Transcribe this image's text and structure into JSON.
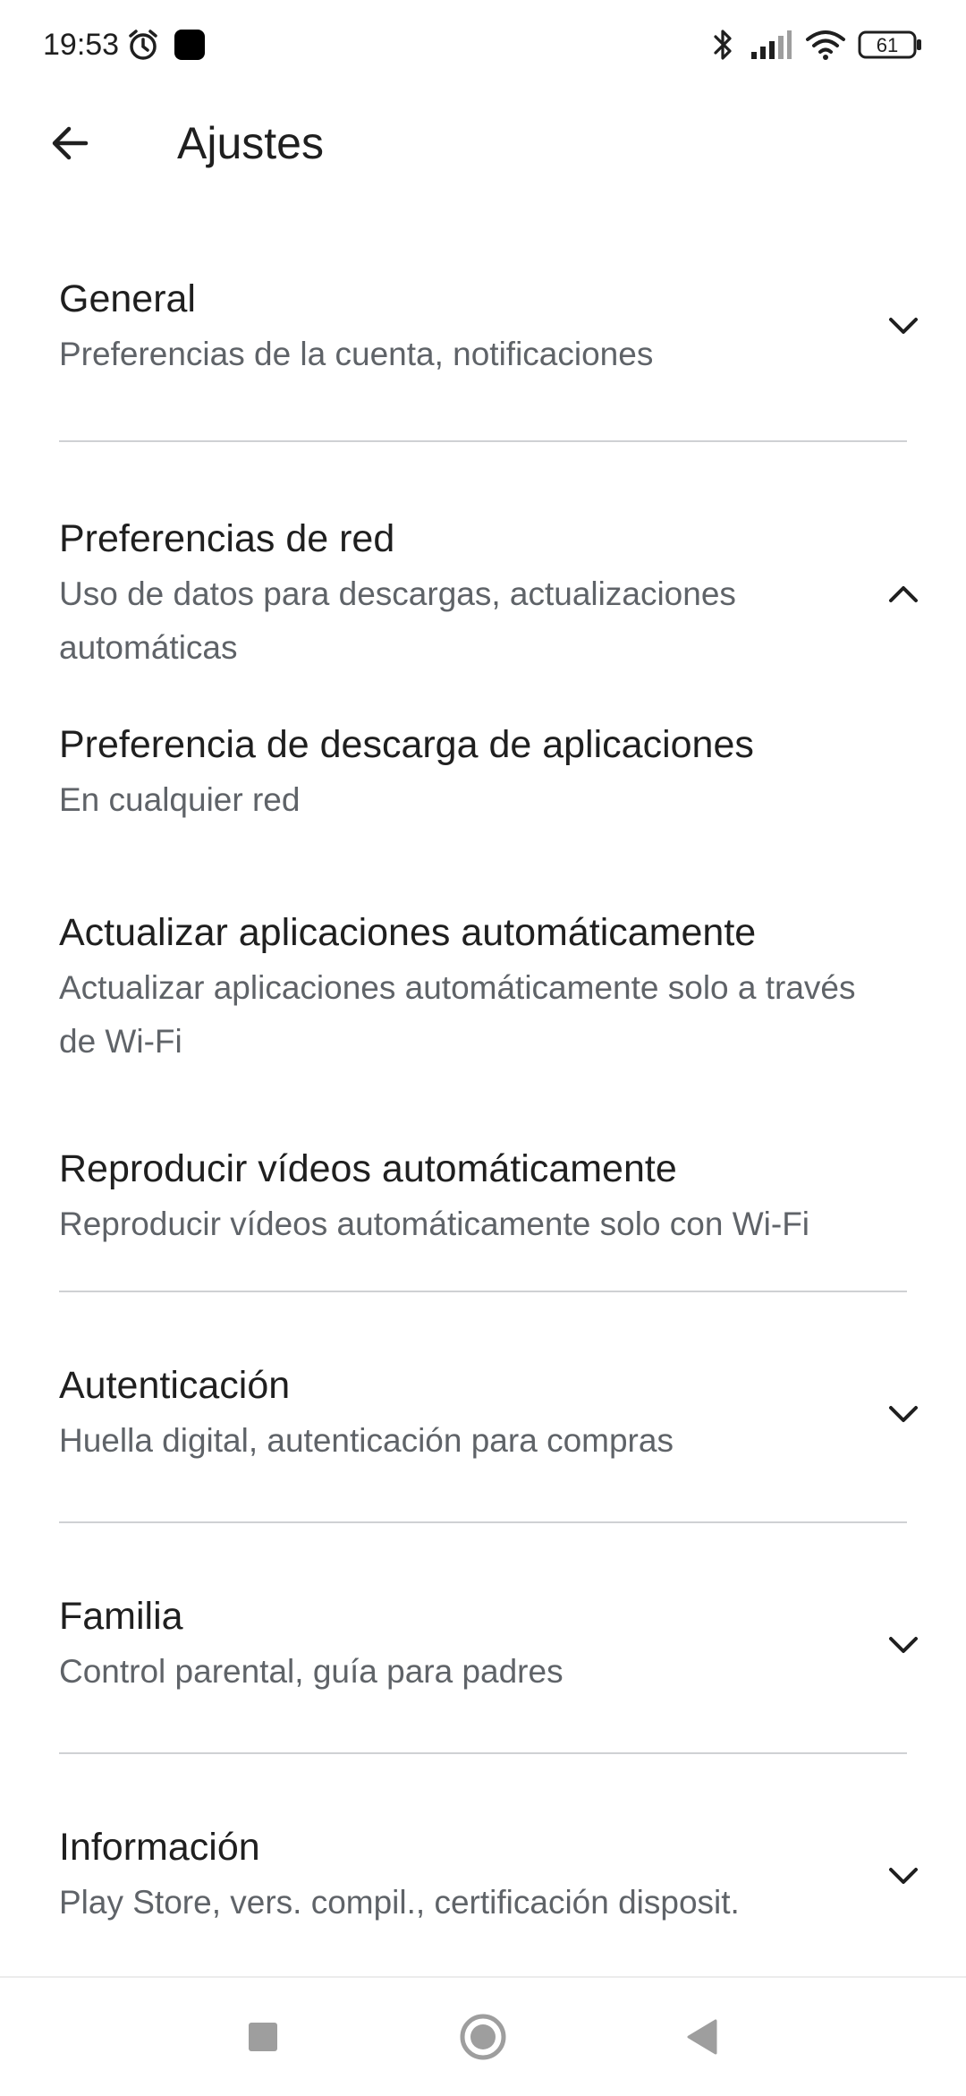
{
  "status_bar": {
    "time": "19:53",
    "battery_level": "61",
    "icons": [
      "alarm-icon",
      "app-notification-icon",
      "bluetooth-icon",
      "signal-icon",
      "wifi-icon",
      "battery-icon"
    ]
  },
  "app_bar": {
    "back_icon": "arrow-back-icon",
    "title": "Ajustes"
  },
  "sections": {
    "general": {
      "title": "General",
      "subtitle": "Preferencias de la cuenta, notificaciones",
      "expanded": false
    },
    "network": {
      "title": "Preferencias de red",
      "subtitle": "Uso de datos para descargas, actualizaciones automáticas",
      "expanded": true,
      "items": {
        "download": {
          "title": "Preferencia de descarga de aplicaciones",
          "subtitle": "En cualquier red"
        },
        "auto_update": {
          "title": "Actualizar aplicaciones automáticamente",
          "subtitle": "Actualizar aplicaciones automáticamente solo a través de Wi-Fi"
        },
        "autoplay": {
          "title": "Reproducir vídeos automáticamente",
          "subtitle": "Reproducir vídeos automáticamente solo con Wi-Fi"
        }
      }
    },
    "auth": {
      "title": "Autenticación",
      "subtitle": "Huella digital, autenticación para compras",
      "expanded": false
    },
    "family": {
      "title": "Familia",
      "subtitle": "Control parental, guía para padres",
      "expanded": false
    },
    "info": {
      "title": "Información",
      "subtitle": "Play Store, vers. compil., certificación disposit.",
      "expanded": false
    }
  },
  "nav_bar": {
    "buttons": [
      "recents-icon",
      "home-icon",
      "back-triangle-icon"
    ]
  },
  "colors": {
    "text_primary": "#1f1f1f",
    "text_secondary": "#5f6368",
    "divider": "#cfd1d4",
    "nav_icon": "#9e9e9e"
  }
}
